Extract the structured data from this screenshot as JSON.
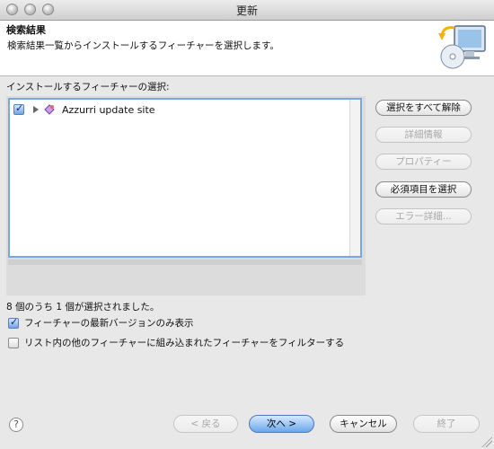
{
  "window": {
    "title": "更新"
  },
  "banner": {
    "title": "検索結果",
    "description": "検索結果一覧からインストールするフィーチャーを選択します。"
  },
  "list": {
    "label": "インストールするフィーチャーの選択:",
    "items": [
      {
        "label": "Azzurri update site",
        "checked": true,
        "expanded": false
      }
    ]
  },
  "side_buttons": {
    "deselect_all": "選択をすべて解除",
    "details": "詳細情報",
    "properties": "プロパティー",
    "select_required": "必須項目を選択",
    "error_details": "エラー詳細..."
  },
  "status": "8 個のうち 1 個が選択されました。",
  "options": {
    "latest_only": {
      "label": "フィーチャーの最新バージョンのみ表示",
      "checked": true
    },
    "filter_included": {
      "label": "リスト内の他のフィーチャーに組み込まれたフィーチャーをフィルターする",
      "checked": false
    }
  },
  "footer": {
    "help": "?",
    "back": "< 戻る",
    "next": "次へ >",
    "cancel": "キャンセル",
    "finish": "終了"
  },
  "colors": {
    "accent": "#6aa7ec",
    "list_border": "#7aa7e0"
  }
}
